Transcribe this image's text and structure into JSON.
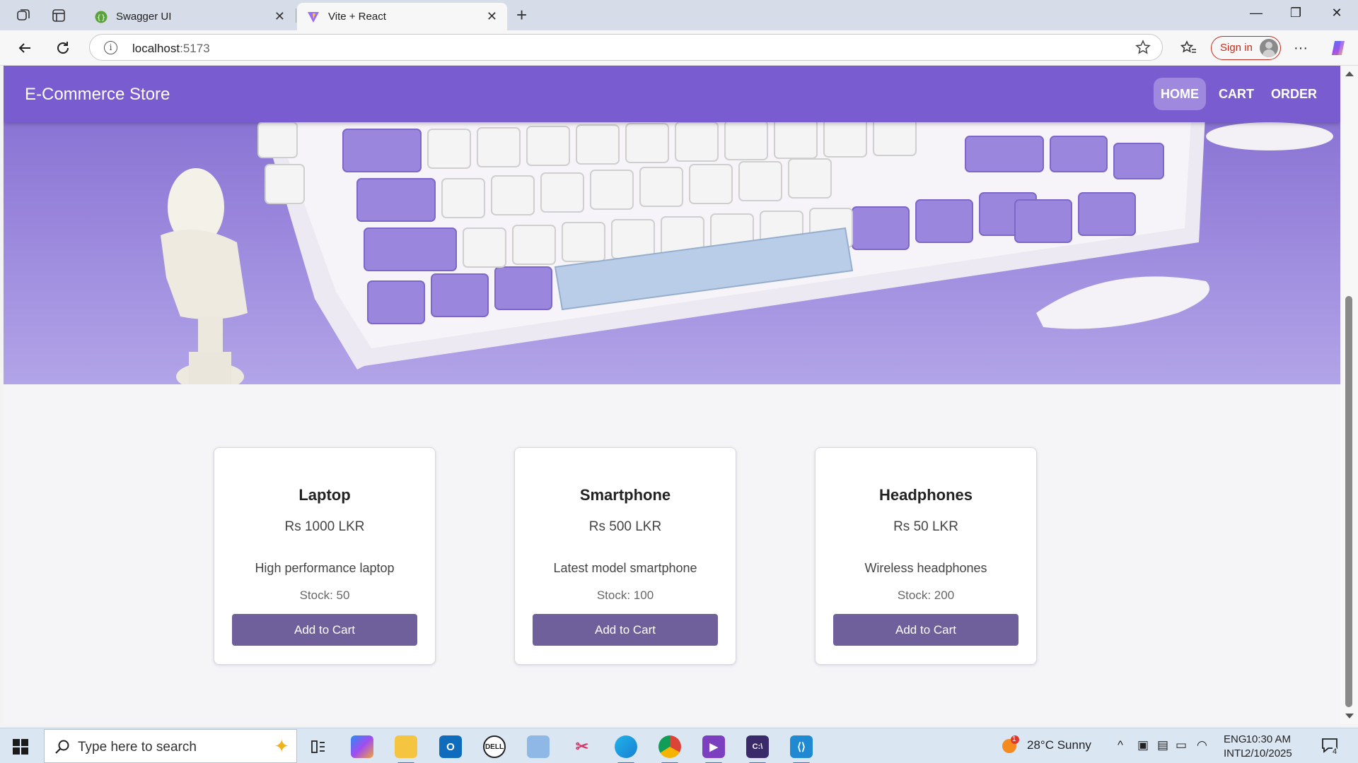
{
  "browser": {
    "tabs": [
      {
        "title": "Swagger UI",
        "active": false
      },
      {
        "title": "Vite + React",
        "active": true
      }
    ],
    "url_host": "localhost",
    "url_port": ":5173",
    "signin_label": "Sign in"
  },
  "app": {
    "brand": "E-Commerce Store",
    "nav": [
      {
        "label": "HOME",
        "active": true
      },
      {
        "label": "CART",
        "active": false
      },
      {
        "label": "ORDER",
        "active": false
      }
    ],
    "accent_color": "#7a5cd1",
    "button_color": "#6f5f9b"
  },
  "products": [
    {
      "name": "Laptop",
      "price": "Rs 1000 LKR",
      "description": "High performance laptop",
      "stock": "Stock: 50",
      "button": "Add to Cart"
    },
    {
      "name": "Smartphone",
      "price": "Rs 500 LKR",
      "description": "Latest model smartphone",
      "stock": "Stock: 100",
      "button": "Add to Cart"
    },
    {
      "name": "Headphones",
      "price": "Rs 50 LKR",
      "description": "Wireless headphones",
      "stock": "Stock: 200",
      "button": "Add to Cart"
    }
  ],
  "taskbar": {
    "search_placeholder": "Type here to search",
    "weather": "28°C  Sunny",
    "weather_badge": "1",
    "lang_line1": "ENG",
    "lang_line2": "INTL",
    "time": "10:30 AM",
    "date": "2/10/2025",
    "notification_count": "4",
    "icons": [
      "task-view-icon",
      "copilot-icon",
      "file-explorer-icon",
      "outlook-icon",
      "dell-icon",
      "folder-icon",
      "snipping-tool-icon",
      "edge-icon",
      "chrome-icon",
      "visual-studio-icon",
      "terminal-icon",
      "vscode-icon"
    ]
  }
}
